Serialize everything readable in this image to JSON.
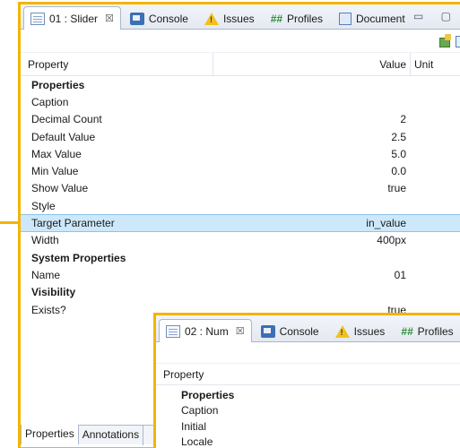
{
  "panel1": {
    "tabs": [
      {
        "label": "01 : Slider",
        "close": "☒",
        "icon": "view-icon"
      },
      {
        "label": "Console",
        "icon": "console-icon"
      },
      {
        "label": "Issues",
        "icon": "warning-icon"
      },
      {
        "label": "Profiles",
        "icon": "hash-icon",
        "prefix": "##"
      },
      {
        "label": "Document",
        "icon": "document-icon"
      }
    ],
    "window_controls": "▭ ▢",
    "header": {
      "property": "Property",
      "value": "Value",
      "unit": "Unit"
    },
    "rows": [
      {
        "type": "group",
        "property": "Properties",
        "value": ""
      },
      {
        "type": "item",
        "property": "Caption",
        "value": ""
      },
      {
        "type": "item",
        "property": "Decimal Count",
        "value": "2"
      },
      {
        "type": "item",
        "property": "Default Value",
        "value": "2.5"
      },
      {
        "type": "item",
        "property": "Max Value",
        "value": "5.0"
      },
      {
        "type": "item",
        "property": "Min Value",
        "value": "0.0"
      },
      {
        "type": "item",
        "property": "Show Value",
        "value": "true"
      },
      {
        "type": "item",
        "property": "Style",
        "value": ""
      },
      {
        "type": "item",
        "property": "Target Parameter",
        "value": "in_value",
        "selected": true
      },
      {
        "type": "item",
        "property": "Width",
        "value": "400px"
      },
      {
        "type": "group",
        "property": "System Properties",
        "value": ""
      },
      {
        "type": "item",
        "property": "Name",
        "value": "01"
      },
      {
        "type": "group",
        "property": "Visibility",
        "value": ""
      },
      {
        "type": "item",
        "property": "Exists?",
        "value": "true"
      }
    ],
    "bottom_tabs": [
      "Properties",
      "Annotations"
    ]
  },
  "panel2": {
    "tabs": [
      {
        "label": "02 : Num",
        "close": "☒",
        "icon": "view-icon"
      },
      {
        "label": "Console",
        "icon": "console-icon"
      },
      {
        "label": "Issues",
        "icon": "warning-icon"
      },
      {
        "label": "Profiles",
        "icon": "hash-icon",
        "prefix": "##"
      }
    ],
    "header": {
      "property": "Property"
    },
    "rows": [
      {
        "type": "group",
        "property": "Properties"
      },
      {
        "type": "item",
        "property": "Caption"
      },
      {
        "type": "item",
        "property": "Initial"
      },
      {
        "type": "item",
        "property": "Locale"
      }
    ]
  },
  "colors": {
    "highlight_border": "#f4b400",
    "selected_row": "#cde8fb",
    "tab_bar": "#e4e9f1"
  }
}
